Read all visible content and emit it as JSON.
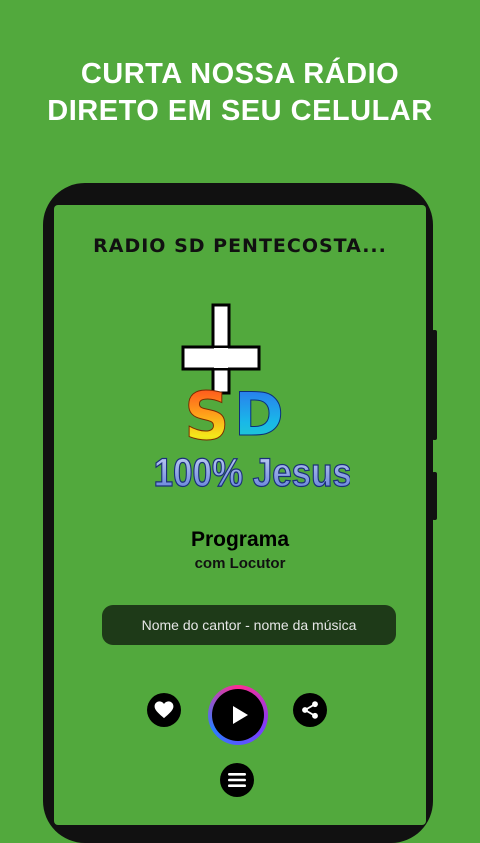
{
  "promo": {
    "line1": "CURTA NOSSA RÁDIO",
    "line2": "DIRETO EM SEU CELULAR"
  },
  "app": {
    "station_name": "RADIO SD PENTECOSTA...",
    "logo": {
      "letters": "SD",
      "tagline": "100% Jesus"
    },
    "program_title": "Programa",
    "program_host": "com Locutor",
    "now_playing": "Nome do cantor - nome da música"
  },
  "controls": {
    "favorite_icon": "heart-icon",
    "play_icon": "play-icon",
    "share_icon": "share-icon",
    "menu_icon": "menu-icon"
  },
  "colors": {
    "background": "#52a93d",
    "now_playing_bg": "#1e3a18",
    "phone_frame": "#111111"
  }
}
